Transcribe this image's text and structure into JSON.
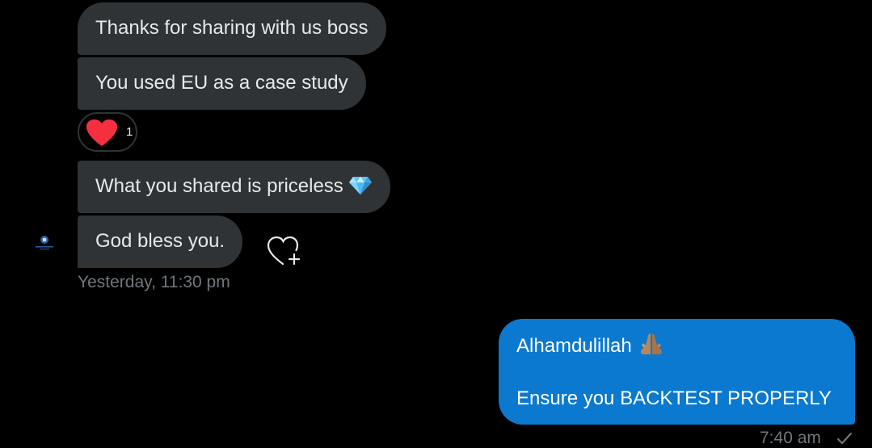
{
  "conversation": {
    "received": [
      {
        "text": "Thanks for sharing with us boss"
      },
      {
        "text": "You used EU as a case study",
        "reaction": {
          "emoji": "heart",
          "count": "1"
        }
      },
      {
        "text": "What you shared is priceless",
        "trailing_emoji": "gem-stone"
      },
      {
        "text": "God bless you."
      }
    ],
    "received_timestamp": "Yesterday, 11:30 pm",
    "sent": {
      "line1": "Alhamdulillah",
      "line1_emoji": "folded-hands",
      "line2": "Ensure you BACKTEST PROPERLY",
      "timestamp": "7:40 am",
      "status": "sent-check"
    }
  },
  "colors": {
    "background": "#000000",
    "received_bubble": "#2f3336",
    "sent_bubble": "#0b79d0",
    "heart": "#f91880",
    "muted_text": "#71767b"
  }
}
